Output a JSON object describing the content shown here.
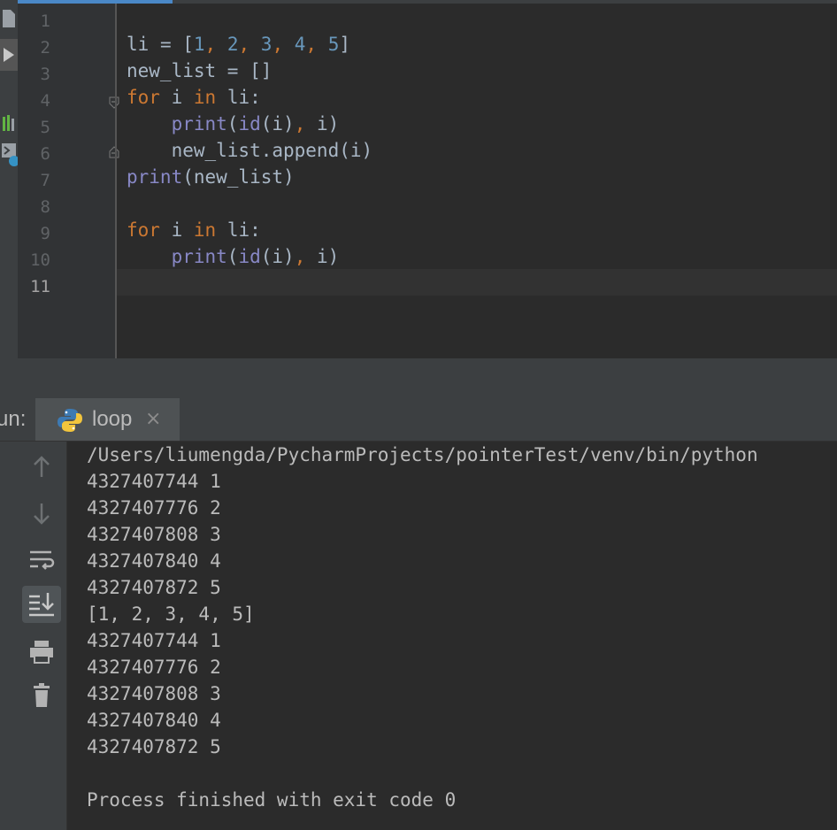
{
  "editor": {
    "line_numbers": [
      "1",
      "2",
      "3",
      "4",
      "5",
      "6",
      "7",
      "8",
      "9",
      "10",
      "11"
    ],
    "current_line": "11"
  },
  "code": {
    "line2": {
      "var": "li",
      "eq": " = [",
      "n1": "1",
      "c1": ", ",
      "n2": "2",
      "c2": ", ",
      "n3": "3",
      "c3": ", ",
      "n4": "4",
      "c4": ", ",
      "n5": "5",
      "end": "]"
    },
    "line3": {
      "text": "new_list = []"
    },
    "line4": {
      "kw_for": "for",
      "mid": " i ",
      "kw_in": "in",
      "rest": " li:"
    },
    "line5": {
      "indent": "    ",
      "fn_print": "print",
      "open": "(",
      "fn_id": "id",
      "args": "(i)",
      "comma": ",",
      "rest": " i)"
    },
    "line6": {
      "text": "    new_list.append(i)"
    },
    "line7": {
      "fn_print": "print",
      "rest": "(new_list)"
    },
    "line9": {
      "kw_for": "for",
      "mid": " i ",
      "kw_in": "in",
      "rest": " li:"
    },
    "line10": {
      "indent": "    ",
      "fn_print": "print",
      "open": "(",
      "fn_id": "id",
      "args": "(i)",
      "comma": ",",
      "rest": " i)"
    }
  },
  "run_panel": {
    "title": "un:",
    "tab_label": "loop",
    "tab_close": "×"
  },
  "console": {
    "lines": [
      "/Users/liumengda/PycharmProjects/pointerTest/venv/bin/python",
      "4327407744 1",
      "4327407776 2",
      "4327407808 3",
      "4327407840 4",
      "4327407872 5",
      "[1, 2, 3, 4, 5]",
      "4327407744 1",
      "4327407776 2",
      "4327407808 3",
      "4327407840 4",
      "4327407872 5",
      "",
      "Process finished with exit code 0"
    ]
  },
  "toolbar_icons": [
    "arrow-up-icon",
    "arrow-down-icon",
    "soft-wrap-icon",
    "scroll-to-end-icon",
    "print-icon",
    "trash-icon"
  ],
  "colors": {
    "keyword": "#cc7832",
    "number": "#6897bb",
    "builtin": "#8888c6",
    "text": "#a9b7c6",
    "background": "#2b2b2b",
    "panel": "#3c3f41"
  }
}
